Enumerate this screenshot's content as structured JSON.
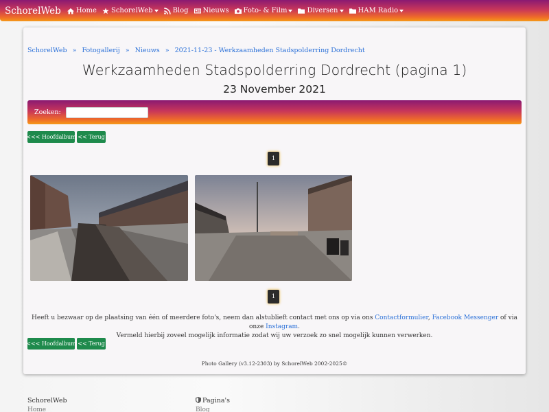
{
  "navbar": {
    "brand": "SchorelWeb",
    "items": [
      {
        "label": "Home",
        "icon": "home-icon",
        "dropdown": false
      },
      {
        "label": "SchorelWeb",
        "icon": "star-icon",
        "dropdown": true
      },
      {
        "label": "Blog",
        "icon": "rss-icon",
        "dropdown": false
      },
      {
        "label": "Nieuws",
        "icon": "newspaper-icon",
        "dropdown": false
      },
      {
        "label": "Foto- & Film",
        "icon": "camera-icon",
        "dropdown": true
      },
      {
        "label": "Diversen",
        "icon": "folder-icon",
        "dropdown": true
      },
      {
        "label": "HAM Radio",
        "icon": "folder-icon",
        "dropdown": true
      }
    ]
  },
  "breadcrumb": [
    "SchorelWeb",
    "Fotogallerij",
    "Nieuws",
    "2021-11-23 - Werkzaamheden Stadspolderring Dordrecht"
  ],
  "breadcrumb_sep": "»",
  "page": {
    "title": "Werkzaamheden Stadspolderring Dordrecht (pagina 1)",
    "date": "23 November 2021"
  },
  "search": {
    "label": "Zoeken:",
    "value": ""
  },
  "buttons": {
    "main_album": "<<< Hoofdalbum",
    "back": "<< Terug"
  },
  "pagination": {
    "current": "1"
  },
  "notice": {
    "text1": "Heeft u bezwaar op de plaatsing van één of meerdere foto's, neem dan alstublieft contact met ons op via ons ",
    "link1": "Contactformulier",
    "sep1": ", ",
    "link2": "Facebook Messenger",
    "text2": " of via onze ",
    "link3": "Instagram",
    "text3": ".",
    "line2": "Vermeld hierbij zoveel mogelijk informatie zodat wij uw verzoek zo snel mogelijk kunnen verwerken."
  },
  "credit": "Photo Gallery (v3.12-2303) by SchorelWeb 2002-2025©",
  "footer": {
    "col1": {
      "title": "SchorelWeb",
      "first": "Home"
    },
    "col2": {
      "title": "Pagina's",
      "icon": "shield-icon",
      "first": "Blog"
    }
  },
  "colors": {
    "accent_green": "#1e8a4c",
    "link": "#2a70d8",
    "gradient_start": "#8a1a72",
    "gradient_end": "#f59a18"
  }
}
